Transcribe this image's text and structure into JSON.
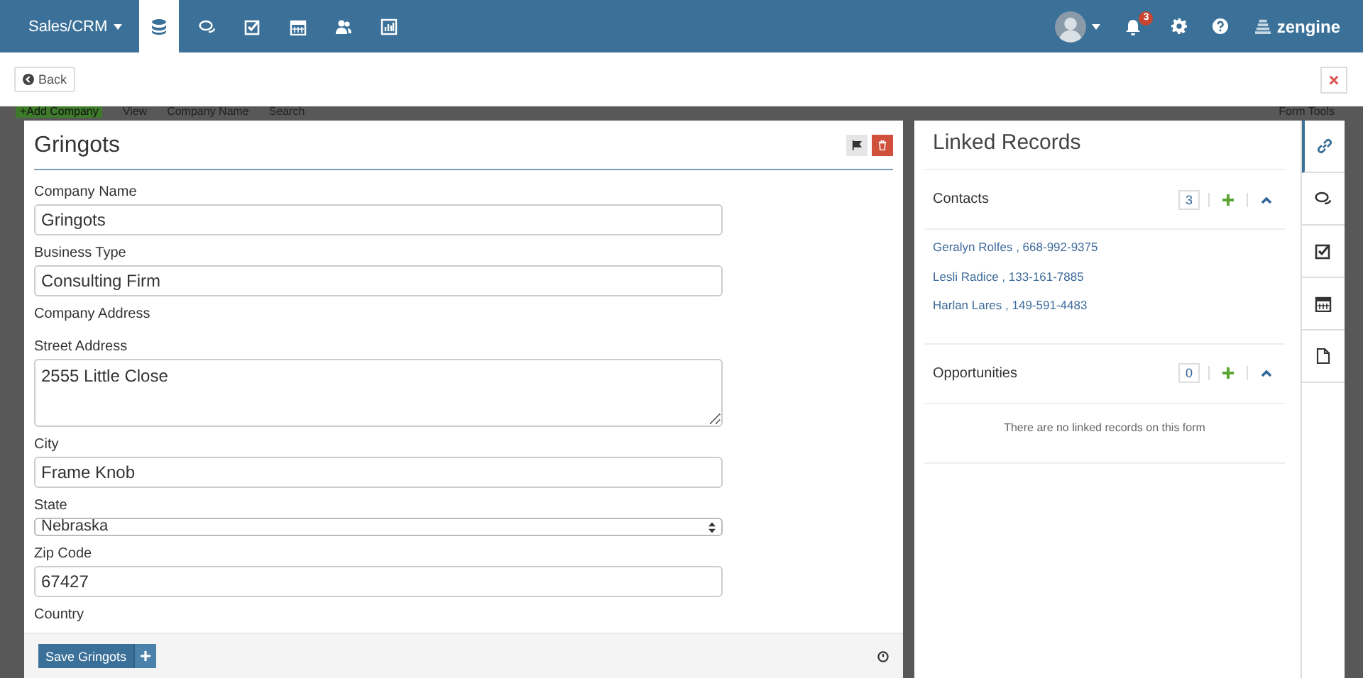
{
  "nav": {
    "app_menu": "Sales/CRM",
    "tabs": [
      {
        "kind": "database",
        "selected": true
      },
      {
        "kind": "comments",
        "selected": false
      },
      {
        "kind": "tasks",
        "selected": false
      },
      {
        "kind": "calendar",
        "selected": false
      },
      {
        "kind": "users",
        "selected": false
      },
      {
        "kind": "chart",
        "selected": false
      }
    ],
    "notifications": "3",
    "brand": "zengine"
  },
  "subbar": {
    "back": "Back"
  },
  "background_toolbar": {
    "add": "+Add Company",
    "view": "View",
    "sort": "Company Name",
    "search_placeholder": "Search",
    "tools": "Form Tools"
  },
  "record": {
    "title": "Gringots",
    "fields": [
      {
        "kind": "text",
        "label": "Company Name",
        "value": "Gringots"
      },
      {
        "kind": "text",
        "label": "Business Type",
        "value": "Consulting Firm"
      },
      {
        "kind": "heading",
        "label": "Company Address"
      },
      {
        "kind": "textarea",
        "label": "Street Address",
        "value": "2555 Little Close"
      },
      {
        "kind": "text",
        "label": "City",
        "value": "Frame Knob"
      },
      {
        "kind": "select",
        "label": "State",
        "value": "Nebraska"
      },
      {
        "kind": "text",
        "label": "Zip Code",
        "value": "67427"
      },
      {
        "kind": "heading",
        "label": "Country"
      }
    ],
    "save": "Save Gringots"
  },
  "linked": {
    "title": "Linked Records",
    "sections": [
      {
        "name": "Contacts",
        "count": "3",
        "expanded": true,
        "items": [
          "Geralyn Rolfes , 668-992-9375",
          "Lesli Radice , 133-161-7885",
          "Harlan Lares , 149-591-4483"
        ]
      },
      {
        "name": "Opportunities",
        "count": "0",
        "expanded": true,
        "empty": "There are no linked records on this form"
      }
    ]
  },
  "rail": [
    {
      "kind": "link",
      "selected": true
    },
    {
      "kind": "comments",
      "selected": false
    },
    {
      "kind": "tasks",
      "selected": false
    },
    {
      "kind": "calendar",
      "selected": false
    },
    {
      "kind": "file",
      "selected": false
    }
  ]
}
